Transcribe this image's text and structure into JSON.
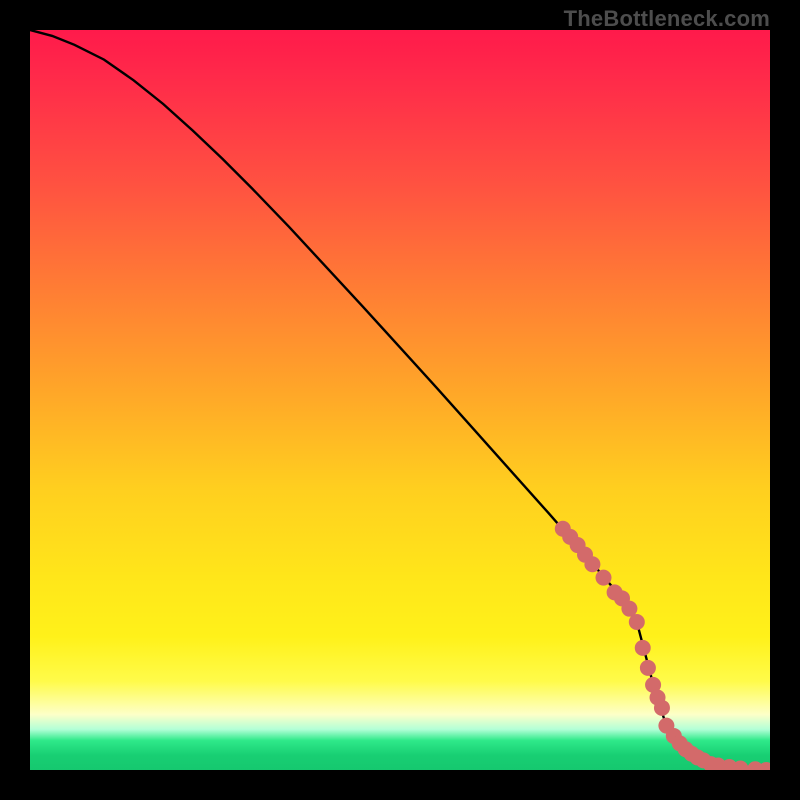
{
  "attribution": "TheBottleneck.com",
  "chart_data": {
    "type": "line",
    "title": "",
    "xlabel": "",
    "ylabel": "",
    "xlim": [
      0,
      100
    ],
    "ylim": [
      0,
      100
    ],
    "grid": false,
    "curve": {
      "name": "bottleneck-curve",
      "color": "#000000",
      "x": [
        0,
        3,
        6,
        10,
        14,
        18,
        22,
        26,
        30,
        35,
        40,
        45,
        50,
        55,
        60,
        65,
        70,
        75,
        80,
        82,
        84.5,
        86,
        88,
        90,
        92,
        94,
        96,
        98,
        99,
        100
      ],
      "y": [
        100,
        99.2,
        98.0,
        96.0,
        93.2,
        90.0,
        86.4,
        82.6,
        78.6,
        73.4,
        68.0,
        62.6,
        57.1,
        51.6,
        46.0,
        40.4,
        34.8,
        29.1,
        23.2,
        20.0,
        10.5,
        6.0,
        3.0,
        1.5,
        0.8,
        0.4,
        0.2,
        0.1,
        0.05,
        0.0
      ]
    },
    "highlight_points": {
      "name": "curve-markers",
      "color": "#d36a6a",
      "radius_px": 8,
      "x": [
        72,
        73,
        74,
        75,
        76,
        77.5,
        79,
        80,
        81,
        82,
        82.8,
        83.5,
        84.2,
        84.8,
        85.4,
        86,
        87,
        87.8,
        88.6,
        89.4,
        90.2,
        91,
        92,
        93,
        94.5,
        96,
        98,
        99.5
      ],
      "y": [
        32.6,
        31.5,
        30.4,
        29.1,
        27.8,
        26.0,
        24.0,
        23.2,
        21.8,
        20.0,
        16.5,
        13.8,
        11.5,
        9.8,
        8.4,
        6.0,
        4.6,
        3.6,
        2.8,
        2.2,
        1.7,
        1.3,
        0.8,
        0.6,
        0.4,
        0.2,
        0.1,
        0.0
      ]
    }
  }
}
